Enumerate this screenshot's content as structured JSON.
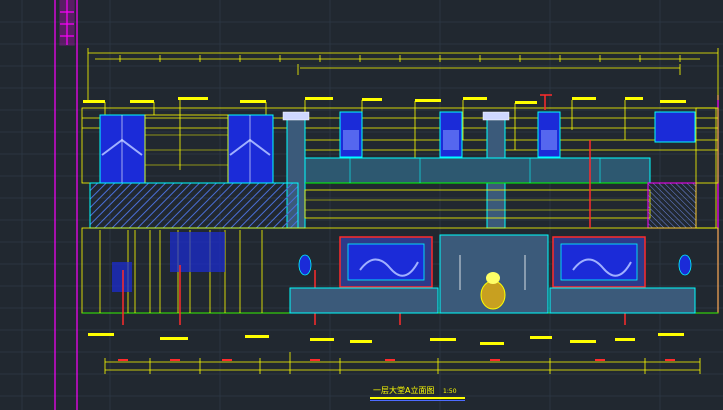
{
  "drawing": {
    "title": "一层大堂A立面图",
    "scale": "1:50",
    "colors": {
      "background": "#212830",
      "grid": "#2e3a46",
      "dimension": "#ffff00",
      "outline": "#00ffff",
      "fill_blue": "#1b2bd8",
      "accent_red": "#ff2a2a",
      "magenta": "#ff00ff",
      "green": "#00ff00",
      "white": "#ffffff"
    }
  }
}
